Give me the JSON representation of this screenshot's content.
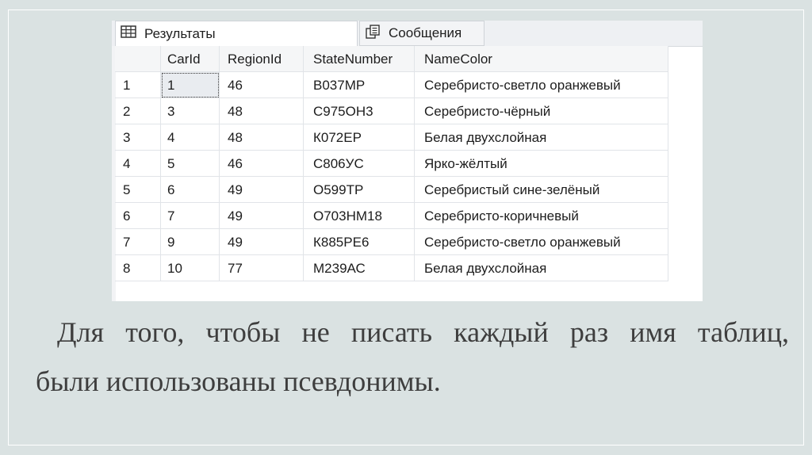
{
  "tabs": {
    "results_label": "Результаты",
    "messages_label": "Сообщения"
  },
  "table": {
    "columns": [
      "",
      "CarId",
      "RegionId",
      "StateNumber",
      "NameColor"
    ],
    "rows": [
      [
        "1",
        "1",
        "46",
        "В037МР",
        "Серебристо-светло оранжевый"
      ],
      [
        "2",
        "3",
        "48",
        "С975ОН3",
        "Серебристо-чёрный"
      ],
      [
        "3",
        "4",
        "48",
        "К072ЕР",
        "Белая двухслойная"
      ],
      [
        "4",
        "5",
        "46",
        "С806УС",
        "Ярко-жёлтый"
      ],
      [
        "5",
        "6",
        "49",
        "О599ТР",
        "Серебристый сине-зелёный"
      ],
      [
        "6",
        "7",
        "49",
        "О703НМ18",
        "Серебристо-коричневый"
      ],
      [
        "7",
        "9",
        "49",
        "К885РЕ6",
        "Серебристо-светло оранжевый"
      ],
      [
        "8",
        "10",
        "77",
        "М239АС",
        "Белая двухслойная"
      ]
    ]
  },
  "caption": {
    "line1": "Для того, чтобы не писать каждый раз имя таблиц,",
    "line2": "были использованы псевдонимы."
  },
  "icons": {
    "results": "grid-icon",
    "messages": "messages-icon"
  },
  "colors": {
    "background": "#dae2e2",
    "selected_cell": "#e9ecf0"
  }
}
